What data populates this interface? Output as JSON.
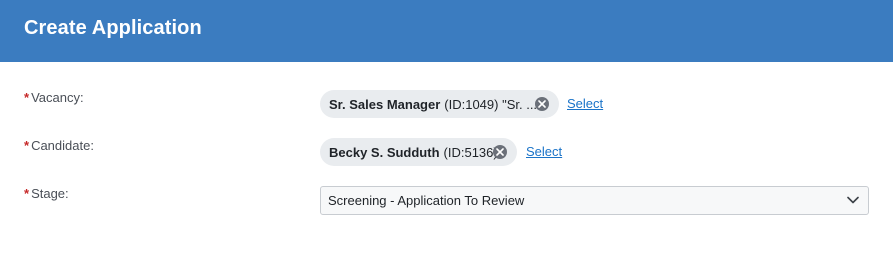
{
  "header": {
    "title": "Create Application"
  },
  "form": {
    "vacancy": {
      "required_marker": "*",
      "label": "Vacancy:",
      "chip_name": "Sr. Sales Manager",
      "chip_detail": "(ID:1049) \"Sr. ...",
      "select_label": "Select"
    },
    "candidate": {
      "required_marker": "*",
      "label": "Candidate:",
      "chip_name": "Becky S. Sudduth",
      "chip_detail": "(ID:5136)",
      "select_label": "Select"
    },
    "stage": {
      "required_marker": "*",
      "label": "Stage:",
      "selected_value": "Screening - Application To Review"
    }
  },
  "colors": {
    "header_bg": "#3b7cc0",
    "required": "#c62828",
    "link": "#1a73c8",
    "chip_bg": "#e9ecef"
  },
  "icons": {
    "chip_remove": "close-circle-icon",
    "dropdown": "chevron-down-icon"
  }
}
